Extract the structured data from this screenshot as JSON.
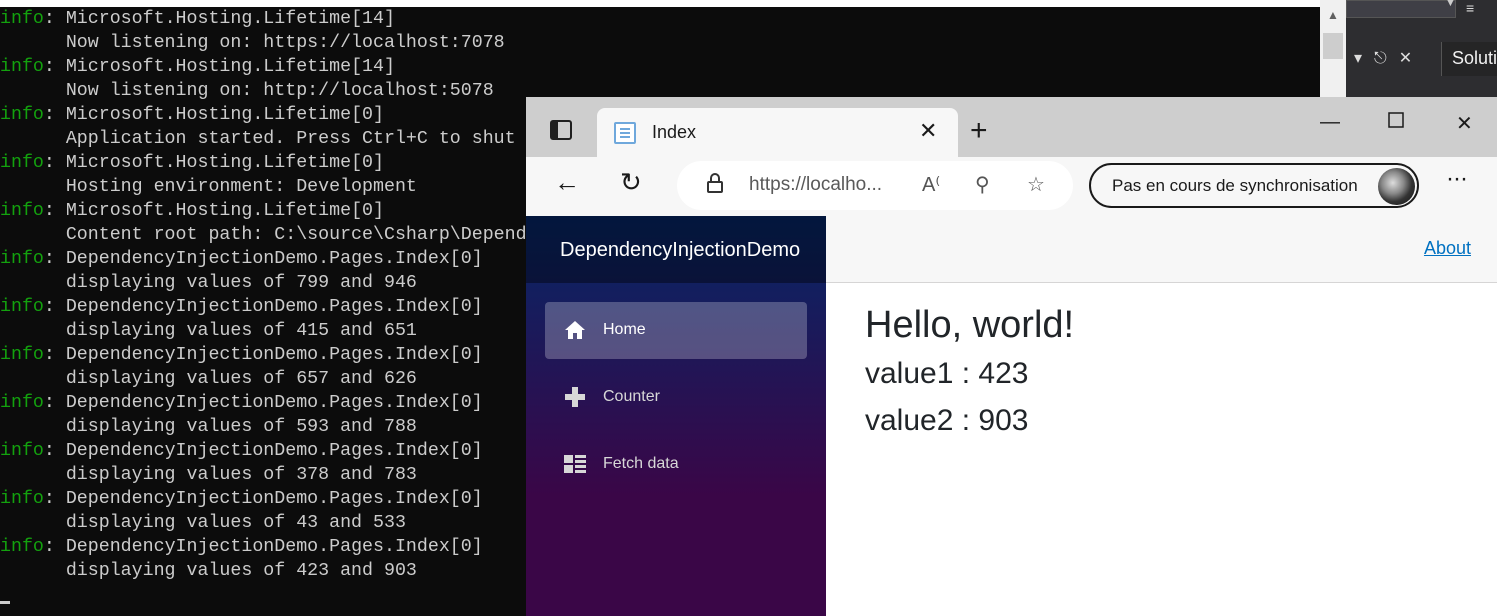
{
  "console": {
    "lines": [
      {
        "level": "info",
        "text": ": Microsoft.Hosting.Lifetime[14]"
      },
      {
        "level": "",
        "text": "      Now listening on: https://localhost:7078"
      },
      {
        "level": "info",
        "text": ": Microsoft.Hosting.Lifetime[14]"
      },
      {
        "level": "",
        "text": "      Now listening on: http://localhost:5078"
      },
      {
        "level": "info",
        "text": ": Microsoft.Hosting.Lifetime[0]"
      },
      {
        "level": "",
        "text": "      Application started. Press Ctrl+C to shut"
      },
      {
        "level": "info",
        "text": ": Microsoft.Hosting.Lifetime[0]"
      },
      {
        "level": "",
        "text": "      Hosting environment: Development"
      },
      {
        "level": "info",
        "text": ": Microsoft.Hosting.Lifetime[0]"
      },
      {
        "level": "",
        "text": "      Content root path: C:\\source\\Csharp\\Depend"
      },
      {
        "level": "info",
        "text": ": DependencyInjectionDemo.Pages.Index[0]"
      },
      {
        "level": "",
        "text": "      displaying values of 799 and 946"
      },
      {
        "level": "info",
        "text": ": DependencyInjectionDemo.Pages.Index[0]"
      },
      {
        "level": "",
        "text": "      displaying values of 415 and 651"
      },
      {
        "level": "info",
        "text": ": DependencyInjectionDemo.Pages.Index[0]"
      },
      {
        "level": "",
        "text": "      displaying values of 657 and 626"
      },
      {
        "level": "info",
        "text": ": DependencyInjectionDemo.Pages.Index[0]"
      },
      {
        "level": "",
        "text": "      displaying values of 593 and 788"
      },
      {
        "level": "info",
        "text": ": DependencyInjectionDemo.Pages.Index[0]"
      },
      {
        "level": "",
        "text": "      displaying values of 378 and 783"
      },
      {
        "level": "info",
        "text": ": DependencyInjectionDemo.Pages.Index[0]"
      },
      {
        "level": "",
        "text": "      displaying values of 43 and 533"
      },
      {
        "level": "info",
        "text": ": DependencyInjectionDemo.Pages.Index[0]"
      },
      {
        "level": "",
        "text": "      displaying values of 423 and 903"
      }
    ],
    "colors": {
      "background": "#0c0c0c",
      "text": "#cccccc",
      "info": "#13a10e"
    }
  },
  "vs": {
    "solution_label": "Soluti"
  },
  "browser": {
    "tab": {
      "title": "Index",
      "close_icon": "close-icon"
    },
    "address": {
      "url": "https://localho..."
    },
    "sync_button": {
      "label": "Pas en cours de synchronisation"
    },
    "app": {
      "brand": "DependencyInjectionDemo",
      "nav": [
        {
          "label": "Home",
          "icon": "home-icon",
          "active": true
        },
        {
          "label": "Counter",
          "icon": "plus-icon",
          "active": false
        },
        {
          "label": "Fetch data",
          "icon": "list-icon",
          "active": false
        }
      ],
      "top_link": "About",
      "heading": "Hello, world!",
      "value1": "value1 : 423",
      "value2": "value2 : 903"
    }
  }
}
